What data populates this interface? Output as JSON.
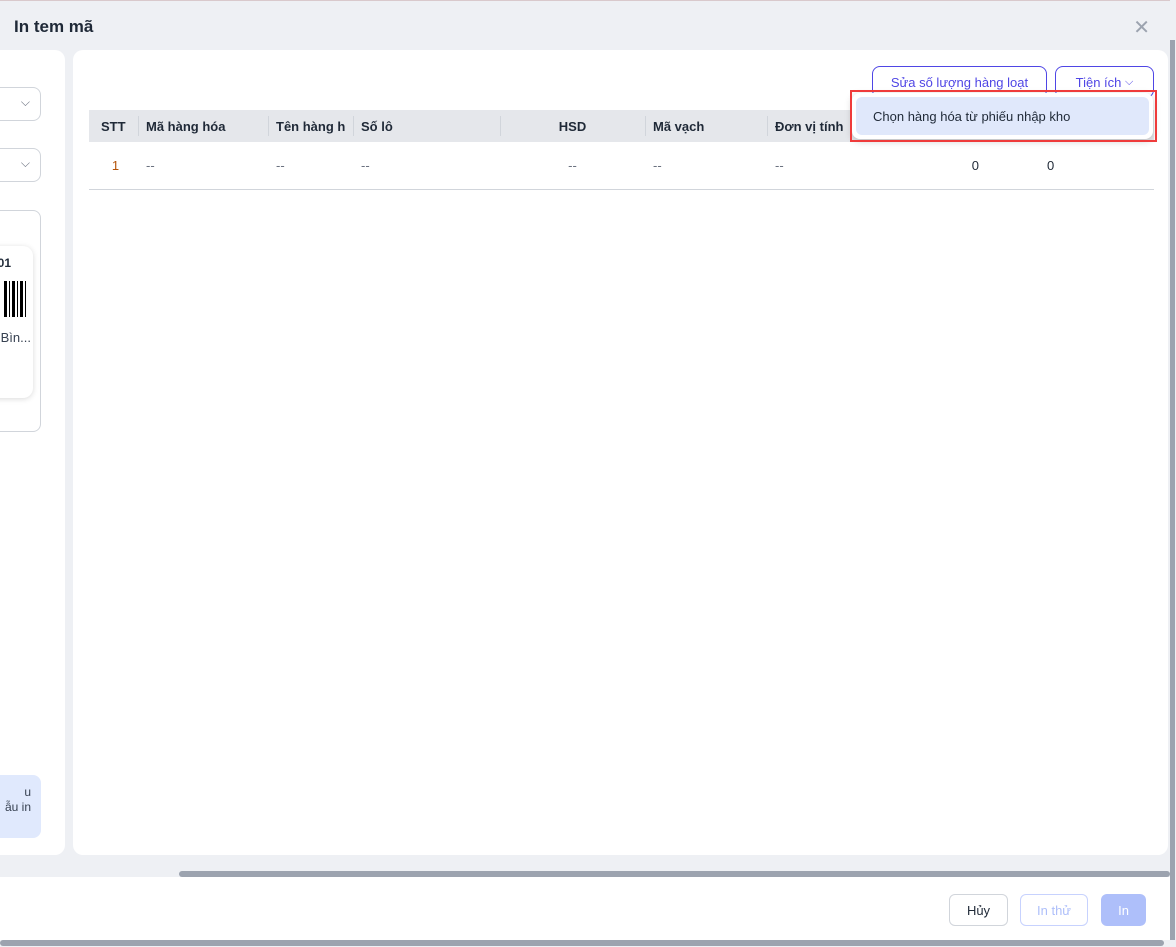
{
  "dialog": {
    "title": "In tem mã",
    "close_icon": "close-icon"
  },
  "left": {
    "preview_code": "01",
    "preview_name": "Bìn...",
    "note_line1": "u",
    "note_line2": "ẫu in"
  },
  "toolbar": {
    "bulk_edit_label": "Sửa số lượng hàng loạt",
    "utilities_label": "Tiện ích"
  },
  "menu": {
    "items": [
      "Chọn hàng hóa từ phiếu nhập kho"
    ]
  },
  "table": {
    "headers": [
      "STT",
      "Mã hàng hóa",
      "Tên hàng h",
      "Số lô",
      "HSD",
      "Mã vạch",
      "Đơn vị tính",
      "",
      ""
    ],
    "rows": [
      [
        "1",
        "--",
        "--",
        "--",
        "--",
        "--",
        "--",
        "0",
        "0"
      ]
    ]
  },
  "footer": {
    "cancel_label": "Hủy",
    "test_print_label": "In thử",
    "print_label": "In"
  },
  "colors": {
    "accent": "#4f46e5",
    "highlight": "#ef3b3b",
    "disabled": "#aebffa"
  }
}
